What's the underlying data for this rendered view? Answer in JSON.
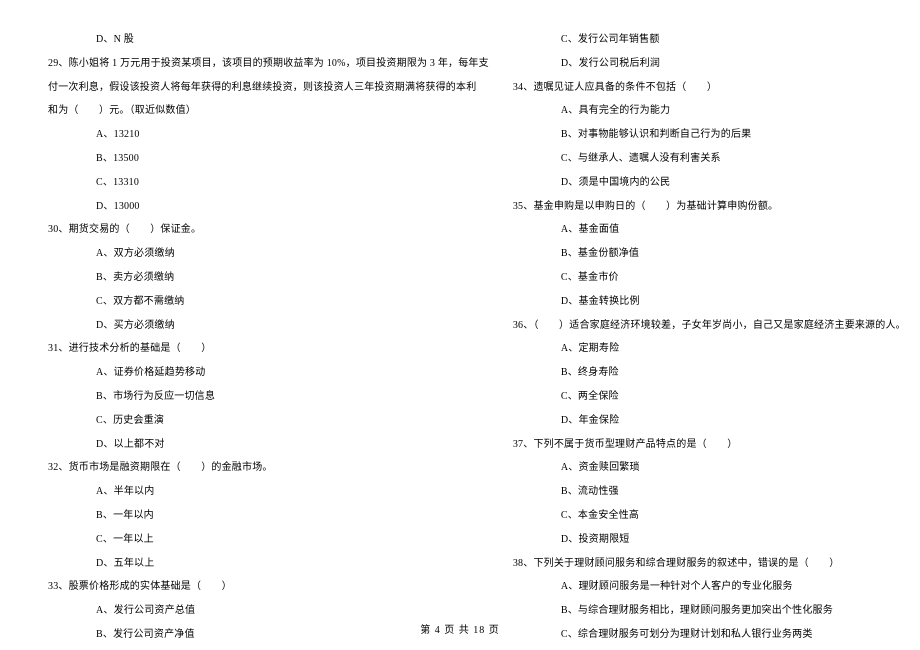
{
  "left_column": {
    "opt_28d": "D、N 股",
    "q29_line1": "29、陈小姐将 1 万元用于投资某项目，该项目的预期收益率为 10%，项目投资期限为 3 年，每年支",
    "q29_line2": "付一次利息，假设该投资人将每年获得的利息继续投资，则该投资人三年投资期满将获得的本利",
    "q29_line3": "和为（　　）元。（取近似数值）",
    "q29_a": "A、13210",
    "q29_b": "B、13500",
    "q29_c": "C、13310",
    "q29_d": "D、13000",
    "q30": "30、期货交易的（　　）保证金。",
    "q30_a": "A、双方必须缴纳",
    "q30_b": "B、卖方必须缴纳",
    "q30_c": "C、双方都不需缴纳",
    "q30_d": "D、买方必须缴纳",
    "q31": "31、进行技术分析的基础是（　　）",
    "q31_a": "A、证券价格延趋势移动",
    "q31_b": "B、市场行为反应一切信息",
    "q31_c": "C、历史会重演",
    "q31_d": "D、以上都不对",
    "q32": "32、货币市场是融资期限在（　　）的金融市场。",
    "q32_a": "A、半年以内",
    "q32_b": "B、一年以内",
    "q32_c": "C、一年以上",
    "q32_d": "D、五年以上",
    "q33": "33、股票价格形成的实体基础是（　　）",
    "q33_a": "A、发行公司资产总值",
    "q33_b": "B、发行公司资产净值"
  },
  "right_column": {
    "q33_c": "C、发行公司年销售额",
    "q33_d": "D、发行公司税后利润",
    "q34": "34、遗嘱见证人应具备的条件不包括（　　）",
    "q34_a": "A、具有完全的行为能力",
    "q34_b": "B、对事物能够认识和判断自己行为的后果",
    "q34_c": "C、与继承人、遗嘱人没有利害关系",
    "q34_d": "D、须是中国境内的公民",
    "q35": "35、基金申购是以申购日的（　　）为基础计算申购份额。",
    "q35_a": "A、基金面值",
    "q35_b": "B、基金份额净值",
    "q35_c": "C、基金市价",
    "q35_d": "D、基金转换比例",
    "q36": "36、（　　）适合家庭经济环境较差，子女年岁尚小，自己又是家庭经济主要来源的人。",
    "q36_a": "A、定期寿险",
    "q36_b": "B、终身寿险",
    "q36_c": "C、两全保险",
    "q36_d": "D、年金保险",
    "q37": "37、下列不属于货币型理财产品特点的是（　　）",
    "q37_a": "A、资金赎回繁琐",
    "q37_b": "B、流动性强",
    "q37_c": "C、本金安全性高",
    "q37_d": "D、投资期限短",
    "q38": "38、下列关于理财顾问服务和综合理财服务的叙述中，错误的是（　　）",
    "q38_a": "A、理财顾问服务是一种针对个人客户的专业化服务",
    "q38_b": "B、与综合理财服务相比，理财顾问服务更加突出个性化服务",
    "q38_c": "C、综合理财服务可划分为理财计划和私人银行业务两类"
  },
  "footer": "第 4 页 共 18 页"
}
